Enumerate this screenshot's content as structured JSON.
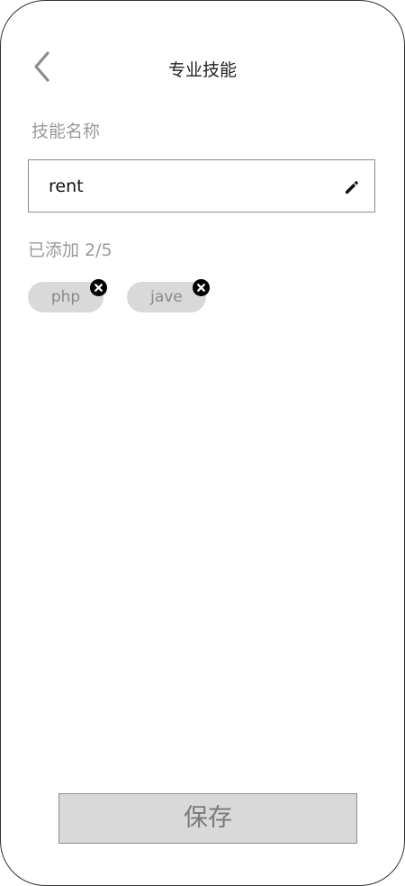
{
  "header": {
    "title": "专业技能",
    "back_icon": "chevron-left-icon"
  },
  "skill_input": {
    "label": "技能名称",
    "value": "rent",
    "edit_icon": "pencil-icon"
  },
  "added": {
    "label": "已添加",
    "count": "2/5",
    "tags": [
      {
        "label": "php",
        "remove_icon": "close-icon"
      },
      {
        "label": "jave",
        "remove_icon": "close-icon"
      }
    ]
  },
  "footer": {
    "save_label": "保存"
  },
  "colors": {
    "border": "#8c8c8c",
    "muted_text": "#9a9a9a",
    "tag_bg": "#d9d9d9",
    "button_bg": "#d9d9d9"
  }
}
